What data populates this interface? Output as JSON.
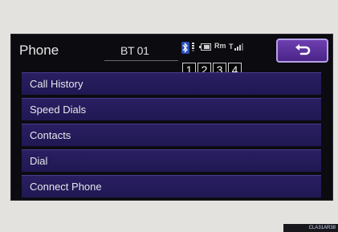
{
  "header": {
    "title": "Phone",
    "device_name": "BT 01",
    "bluetooth_icon": "bluetooth-icon",
    "battery_icon": "battery-icon",
    "roaming_text": "Rm",
    "signal_text": "T",
    "signal_level_fraction": 0.75,
    "slots": [
      "1",
      "2",
      "3",
      "4"
    ],
    "back_icon": "return-arrow-icon"
  },
  "menu": {
    "items": [
      {
        "label": "Call History"
      },
      {
        "label": "Speed Dials"
      },
      {
        "label": "Contacts"
      },
      {
        "label": "Dial"
      },
      {
        "label": "Connect Phone"
      }
    ]
  },
  "figure_code": "CLA31AR38",
  "colors": {
    "screen_bg": "#0b0b10",
    "menu_item_bg": "#2a1f62",
    "back_button": "#6e3fb0",
    "bluetooth_badge": "#2b4fb8"
  }
}
